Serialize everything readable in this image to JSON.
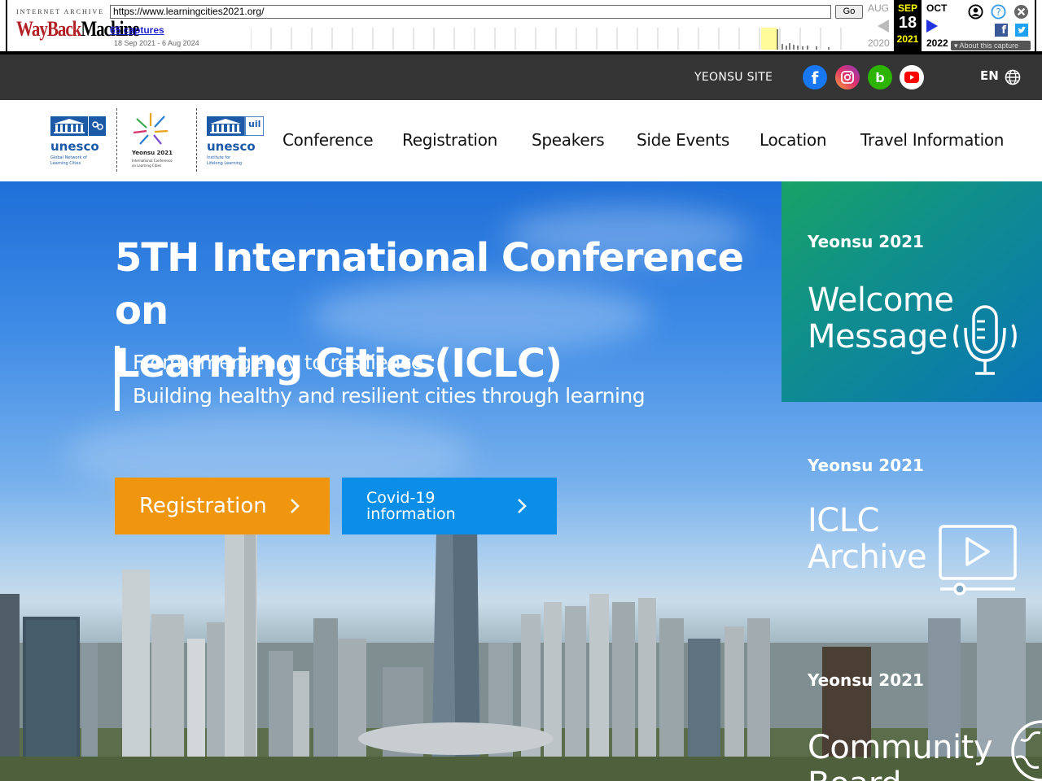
{
  "wayback": {
    "logo_top": "INTERNET ARCHIVE",
    "logo_wayback": "WayBack",
    "logo_machine": "Machine",
    "url": "https://www.learningcities2021.org/",
    "go_label": "Go",
    "captures_label": "65 captures",
    "date_range": "18 Sep 2021 - 6 Aug 2024",
    "prev_month": "AUG",
    "prev_year": "2020",
    "current_month": "SEP",
    "current_day": "18",
    "current_year": "2021",
    "next_month": "OCT",
    "next_year": "2022",
    "about_label": "About this capture"
  },
  "topbar": {
    "site_label": "YEONSU SITE",
    "social": [
      {
        "name": "facebook",
        "glyph": "f",
        "color": "#1877f2"
      },
      {
        "name": "instagram",
        "glyph": "◎",
        "color": "#d62976"
      },
      {
        "name": "blog",
        "glyph": "b",
        "color": "#2db400"
      },
      {
        "name": "youtube",
        "glyph": "▶",
        "color": "#ffffff"
      }
    ],
    "language": "EN"
  },
  "header": {
    "logo1": {
      "brand": "unesco",
      "line1": "Global Network of",
      "line2": "Learning Cities"
    },
    "logo2": {
      "title": "Yeonsu 2021",
      "line1": "International Conference",
      "line2": "on Learning Cities"
    },
    "logo3": {
      "brand": "unesco",
      "badge": "uil",
      "line1": "Institute for",
      "line2": "Lifelong Learning"
    },
    "nav": [
      "Conference",
      "Registration",
      "Speakers",
      "Side Events",
      "Location",
      "Travel Information"
    ]
  },
  "hero": {
    "title_line1": "5TH International Conference on",
    "title_line2": "Learning Cities(ICLC)",
    "subtitle_line1": "From emergency to resilience :",
    "subtitle_line2": "Building healthy and resilient cities through learning",
    "registration_label": "Registration",
    "covid_line1": "Covid-19",
    "covid_line2": "information"
  },
  "panels": [
    {
      "label": "Yeonsu 2021",
      "title_line1": "Welcome",
      "title_line2": "Message",
      "icon": "microphone-icon"
    },
    {
      "label": "Yeonsu 2021",
      "title_line1": "ICLC",
      "title_line2": "Archive",
      "icon": "video-player-icon"
    },
    {
      "label": "Yeonsu 2021",
      "title_line1": "Community",
      "title_line2": "Board",
      "icon": "globe-icon"
    }
  ],
  "colors": {
    "topbar_bg": "#353535",
    "registration_btn": "#f0960e",
    "covid_btn": "#0a8ee8"
  }
}
